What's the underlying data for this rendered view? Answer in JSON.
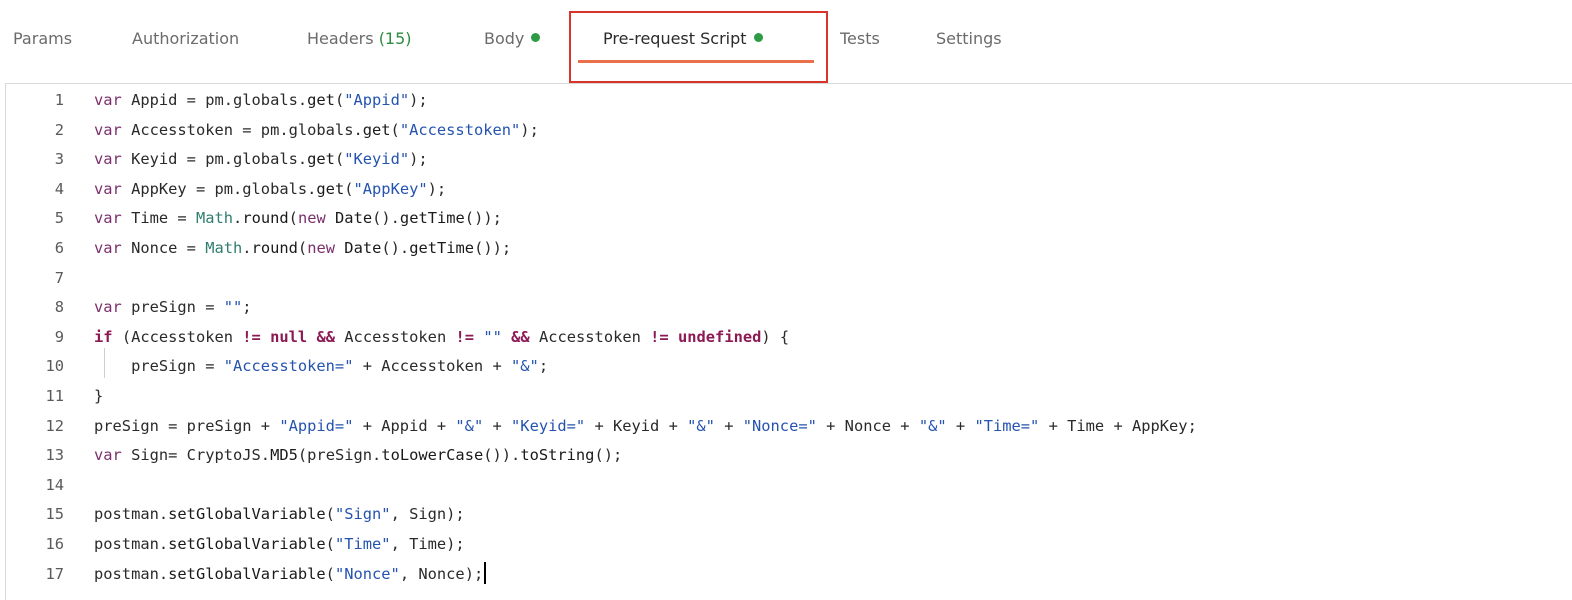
{
  "tabs": [
    {
      "label": "Params"
    },
    {
      "label": "Authorization"
    },
    {
      "label": "Headers",
      "count": "(15)"
    },
    {
      "label": "Body"
    },
    {
      "label": "Pre-request Script"
    },
    {
      "label": "Tests"
    },
    {
      "label": "Settings"
    }
  ],
  "colors": {
    "active_underline": "#e8704a",
    "highlight_box": "#d9342b",
    "status_dot": "#2c9b43",
    "count": "#2e8b3d"
  },
  "editor": {
    "lines": [
      {
        "n": "1",
        "text": "var Appid = pm.globals.get(\"Appid\");"
      },
      {
        "n": "2",
        "text": "var Accesstoken = pm.globals.get(\"Accesstoken\");"
      },
      {
        "n": "3",
        "text": "var Keyid = pm.globals.get(\"Keyid\");"
      },
      {
        "n": "4",
        "text": "var AppKey = pm.globals.get(\"AppKey\");"
      },
      {
        "n": "5",
        "text": "var Time = Math.round(new Date().getTime());"
      },
      {
        "n": "6",
        "text": "var Nonce = Math.round(new Date().getTime());"
      },
      {
        "n": "7",
        "text": ""
      },
      {
        "n": "8",
        "text": "var preSign = \"\";"
      },
      {
        "n": "9",
        "text": "if (Accesstoken != null && Accesstoken != \"\" && Accesstoken != undefined) {"
      },
      {
        "n": "10",
        "text": "    preSign = \"Accesstoken=\" + Accesstoken + \"&\";"
      },
      {
        "n": "11",
        "text": "}"
      },
      {
        "n": "12",
        "text": "preSign = preSign + \"Appid=\" + Appid + \"&\" + \"Keyid=\" + Keyid + \"&\" + \"Nonce=\" + Nonce + \"&\" + \"Time=\" + Time + AppKey;"
      },
      {
        "n": "13",
        "text": "var Sign= CryptoJS.MD5(preSign.toLowerCase()).toString();"
      },
      {
        "n": "14",
        "text": ""
      },
      {
        "n": "15",
        "text": "postman.setGlobalVariable(\"Sign\", Sign);"
      },
      {
        "n": "16",
        "text": "postman.setGlobalVariable(\"Time\", Time);"
      },
      {
        "n": "17",
        "text": "postman.setGlobalVariable(\"Nonce\", Nonce);"
      }
    ]
  }
}
